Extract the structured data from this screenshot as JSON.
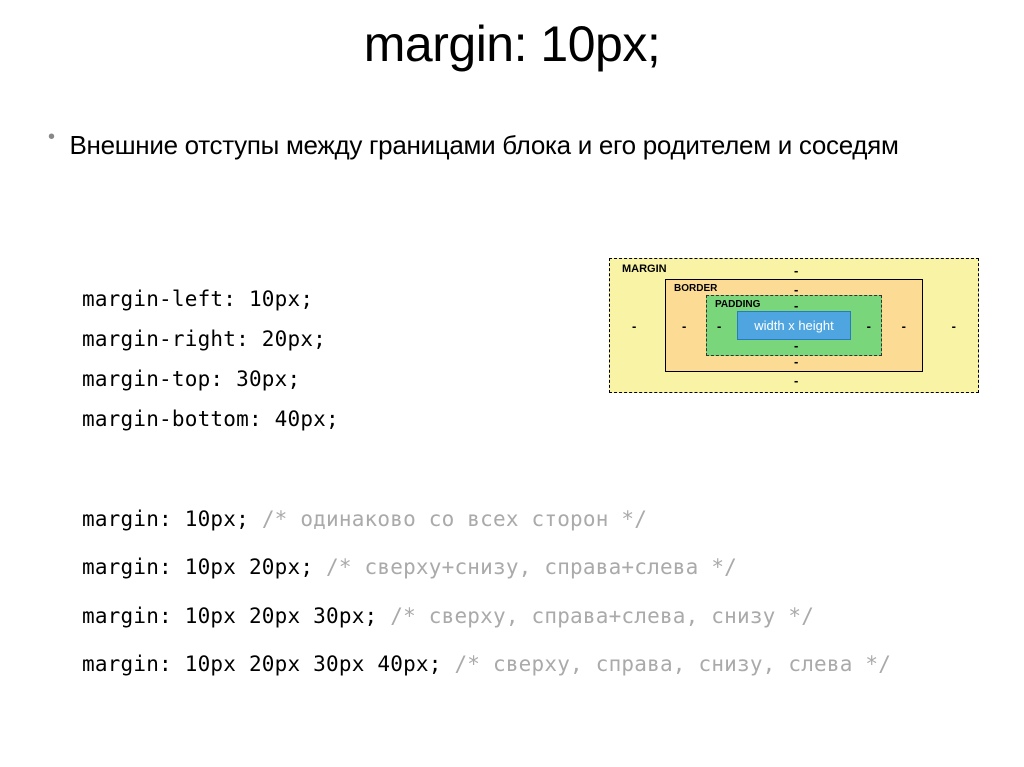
{
  "title": "margin: 10px;",
  "description": "Внешние отступы между границами блока и его родителем и соседям",
  "longhand": {
    "left": "margin-left: 10px;",
    "right": "margin-right: 20px;",
    "top": "margin-top: 30px;",
    "bottom": "margin-bottom: 40px;"
  },
  "boxmodel": {
    "margin": "margin",
    "border": "border",
    "padding": "padding",
    "content": "width x height"
  },
  "shorthand": [
    {
      "code": "margin: 10px;",
      "comment": "/* одинаково со всех сторон */"
    },
    {
      "code": "margin: 10px 20px;",
      "comment": "/* сверху+снизу, справа+слева */"
    },
    {
      "code": "margin: 10px 20px 30px;",
      "comment": "/* сверху, справа+слева, снизу */"
    },
    {
      "code": "margin: 10px 20px 30px 40px;",
      "comment": "/* сверху, справа, снизу, слева */"
    }
  ]
}
